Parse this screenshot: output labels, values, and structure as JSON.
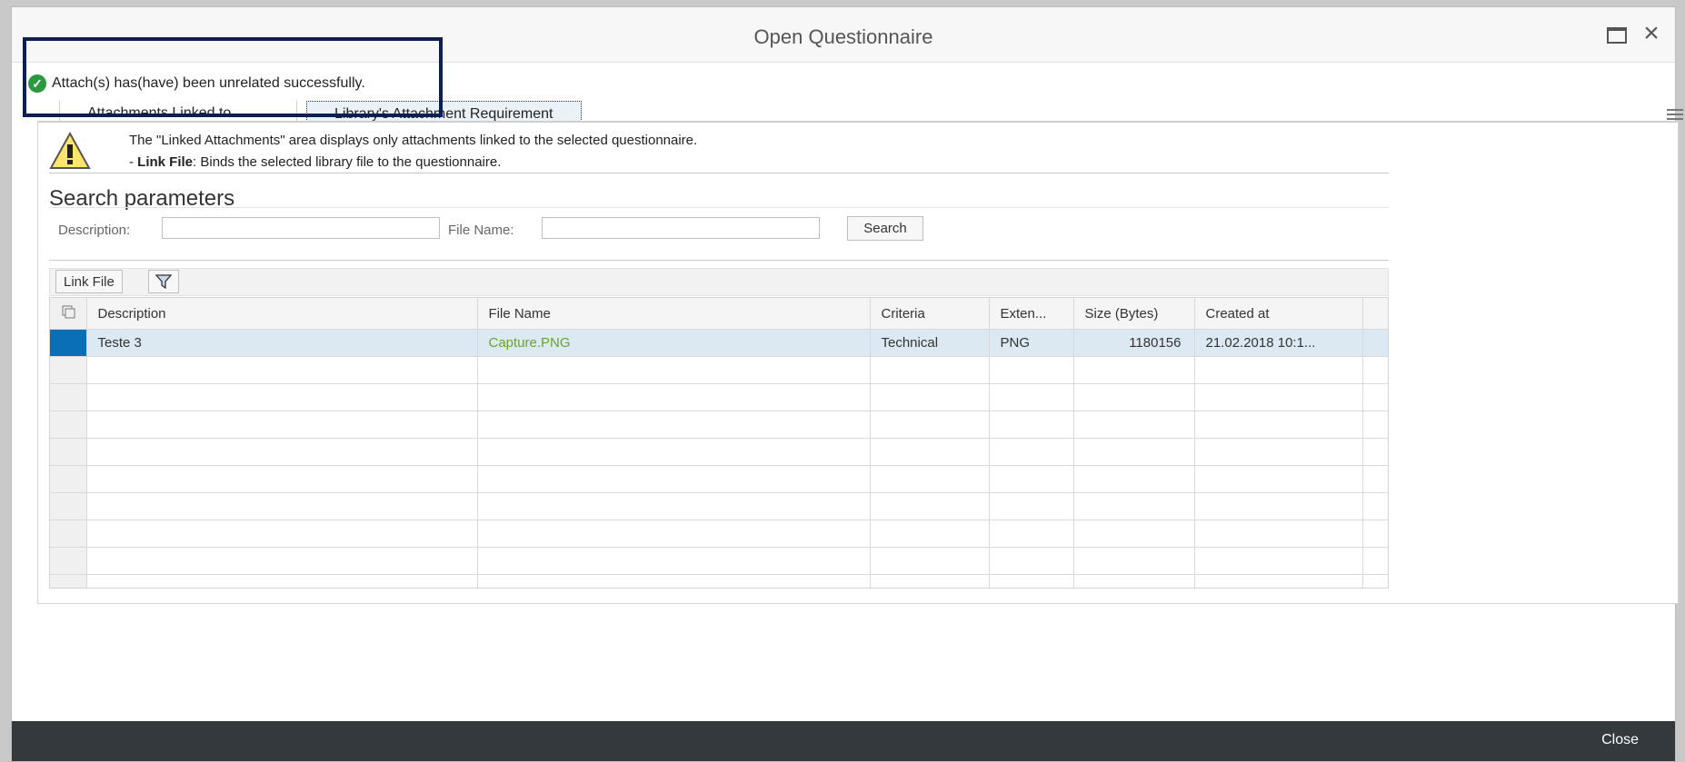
{
  "window": {
    "title": "Open Questionnaire",
    "maximize_icon": "maximize-icon",
    "close_icon": "close-icon"
  },
  "message": {
    "icon": "success-check-icon",
    "text": "Attach(s) has(have) been unrelated successfully."
  },
  "tabs": [
    {
      "label": "Attachments Linked to Items"
    },
    {
      "label": "Library's Attachment Requirement",
      "active": true
    }
  ],
  "info": {
    "icon": "warning-icon",
    "line1": "The \"Linked Attachments\" area displays only attachments linked to the selected questionnaire.",
    "line2_prefix": "- ",
    "line2_bold": "Link File",
    "line2_rest": ": Binds the selected library file to the questionnaire."
  },
  "search": {
    "title": "Search parameters",
    "description_label": "Description:",
    "description_value": "",
    "filename_label": "File Name:",
    "filename_value": "",
    "button": "Search"
  },
  "toolbar": {
    "link_file": "Link File",
    "filter_icon": "filter-icon"
  },
  "table": {
    "columns": [
      "Description",
      "File Name",
      "Criteria",
      "Exten...",
      "Size (Bytes)",
      "Created at"
    ],
    "rows": [
      {
        "description": "Teste 3",
        "file_name": "Capture.PNG",
        "criteria": "Technical",
        "extension": "PNG",
        "size": "1180156",
        "created_at": "21.02.2018 10:1..."
      }
    ]
  },
  "footer": {
    "close": "Close"
  },
  "colors": {
    "selected_row_marker": "#0a6fb7",
    "link_text": "#6aa32d",
    "footer_bg": "#34393d",
    "highlight_border": "#0b1f55"
  }
}
